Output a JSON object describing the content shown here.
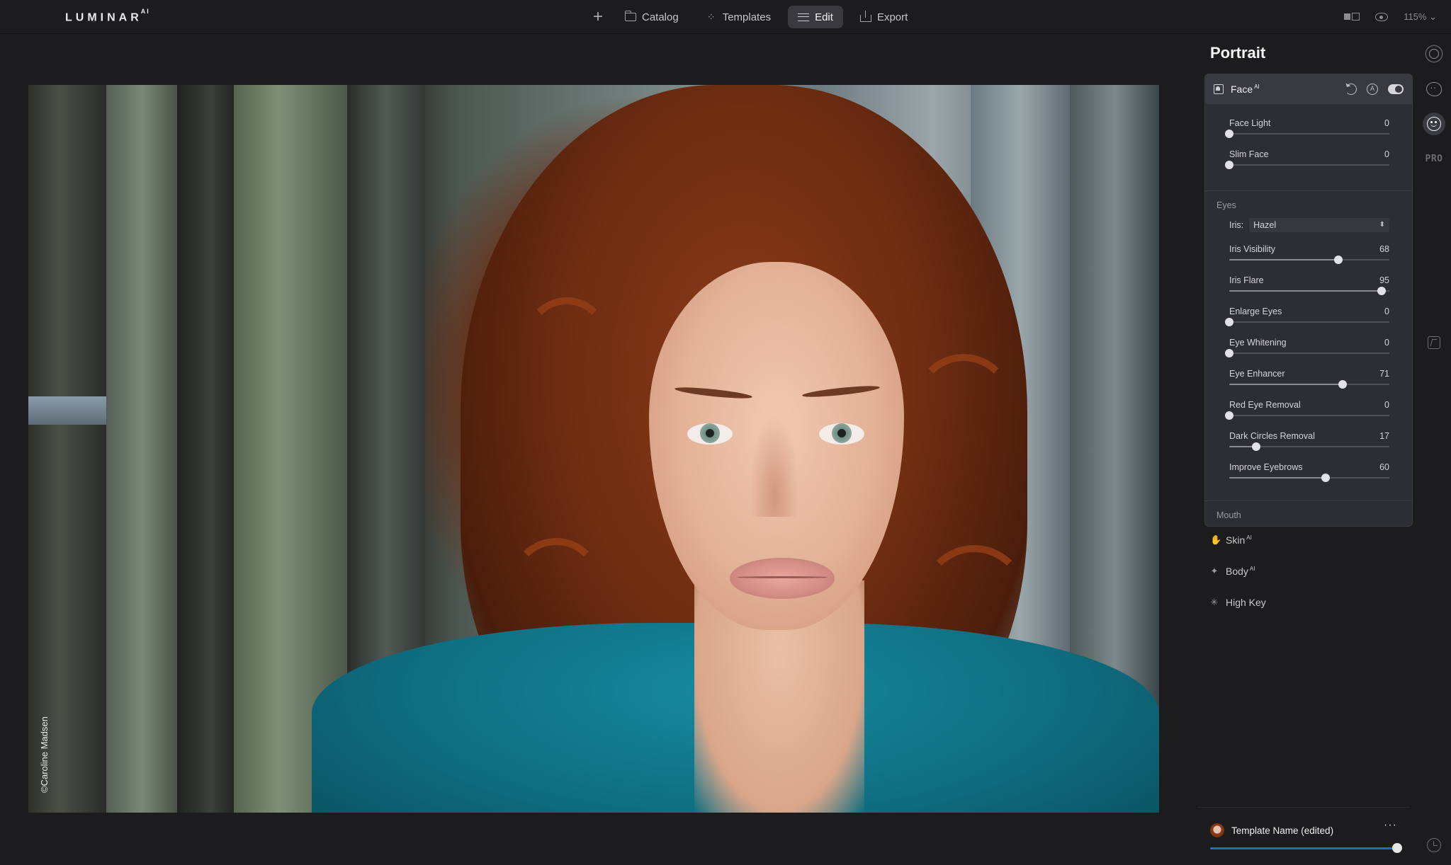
{
  "app": {
    "logo": "LUMINAR",
    "logo_suffix": "AI"
  },
  "nav": {
    "items": [
      {
        "id": "catalog",
        "label": "Catalog",
        "icon": "folder-icon"
      },
      {
        "id": "templates",
        "label": "Templates",
        "icon": "sparkle-icon"
      },
      {
        "id": "edit",
        "label": "Edit",
        "icon": "sliders-icon",
        "active": true
      },
      {
        "id": "export",
        "label": "Export",
        "icon": "export-icon"
      }
    ]
  },
  "top_right": {
    "zoom": "115%"
  },
  "photo": {
    "credit": "©Caroline Madsen"
  },
  "panel": {
    "title": "Portrait",
    "face_tool": {
      "name": "Face",
      "ai_badge": "AI",
      "sliders_top": [
        {
          "label": "Face Light",
          "value": "0",
          "fraction": 0.0
        },
        {
          "label": "Slim Face",
          "value": "0",
          "fraction": 0.0
        }
      ],
      "eyes_section": "Eyes",
      "iris": {
        "label": "Iris:",
        "value": "Hazel"
      },
      "sliders_eyes": [
        {
          "label": "Iris Visibility",
          "value": "68",
          "fraction": 0.68
        },
        {
          "label": "Iris Flare",
          "value": "95",
          "fraction": 0.95
        },
        {
          "label": "Enlarge Eyes",
          "value": "0",
          "fraction": 0.0
        },
        {
          "label": "Eye Whitening",
          "value": "0",
          "fraction": 0.0
        },
        {
          "label": "Eye Enhancer",
          "value": "71",
          "fraction": 0.71
        },
        {
          "label": "Red Eye Removal",
          "value": "0",
          "fraction": 0.0
        },
        {
          "label": "Dark Circles Removal",
          "value": "17",
          "fraction": 0.17
        },
        {
          "label": "Improve Eyebrows",
          "value": "60",
          "fraction": 0.6
        }
      ],
      "mouth_section": "Mouth"
    },
    "other_tools": [
      {
        "label": "Skin",
        "ai": "AI",
        "icon": "hand-icon"
      },
      {
        "label": "Body",
        "ai": "AI",
        "icon": "figure-icon"
      },
      {
        "label": "High Key",
        "ai": "",
        "icon": "sparkle-icon"
      }
    ]
  },
  "template": {
    "name": "Template Name (edited)",
    "more": "···",
    "amount_fraction": 1.0
  },
  "rail": {
    "pro_label": "PRO"
  },
  "colors": {
    "accent": "#2e66c9",
    "panel_bg": "#2d2e33",
    "app_bg": "#1c1c1e"
  }
}
